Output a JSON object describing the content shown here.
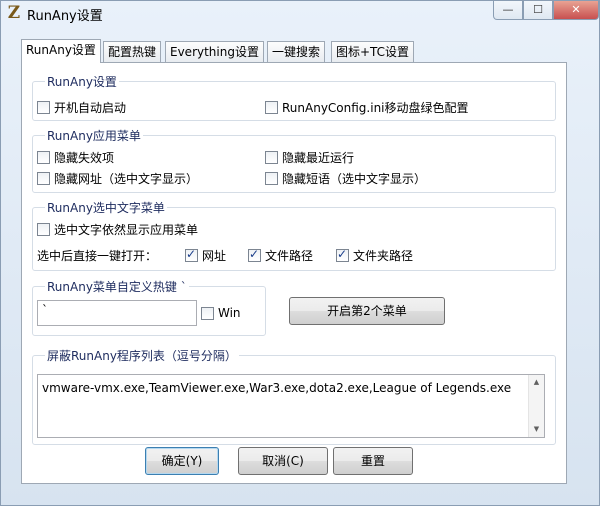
{
  "window": {
    "title": "RunAny设置",
    "app_icon": "Z",
    "minimize_glyph": "—",
    "maximize_glyph": "☐",
    "close_glyph": "✕"
  },
  "tabs": [
    "RunAny设置",
    "配置热键",
    "Everything设置",
    "一键搜索",
    "图标+TC设置"
  ],
  "group_runany": {
    "title": "RunAny设置",
    "autostart": "开机自动启动",
    "portable_config": "RunAnyConfig.ini移动盘绿色配置"
  },
  "group_appmenu": {
    "title": "RunAny应用菜单",
    "hide_invalid": "隐藏失效项",
    "hide_recent": "隐藏最近运行",
    "hide_url": "隐藏网址（选中文字显示）",
    "hide_phrases": "隐藏短语（选中文字显示）"
  },
  "group_textmenu": {
    "title": "RunAny选中文字菜单",
    "show_app_menu": "选中文字依然显示应用菜单",
    "direct_open_label": "选中后直接一键打开：",
    "url": "网址",
    "file_path": "文件路径",
    "folder_path": "文件夹路径"
  },
  "group_hotkey": {
    "title": "RunAny菜单自定义热键 `",
    "hotkey_value": "`",
    "win": "Win"
  },
  "second_menu_button": "开启第2个菜单",
  "group_block": {
    "title": "屏蔽RunAny程序列表（逗号分隔）",
    "list_value": "vmware-vmx.exe,TeamViewer.exe,War3.exe,dota2.exe,League of Legends.exe"
  },
  "buttons": {
    "ok": "确定(Y)",
    "cancel": "取消(C)",
    "reset": "重置"
  }
}
